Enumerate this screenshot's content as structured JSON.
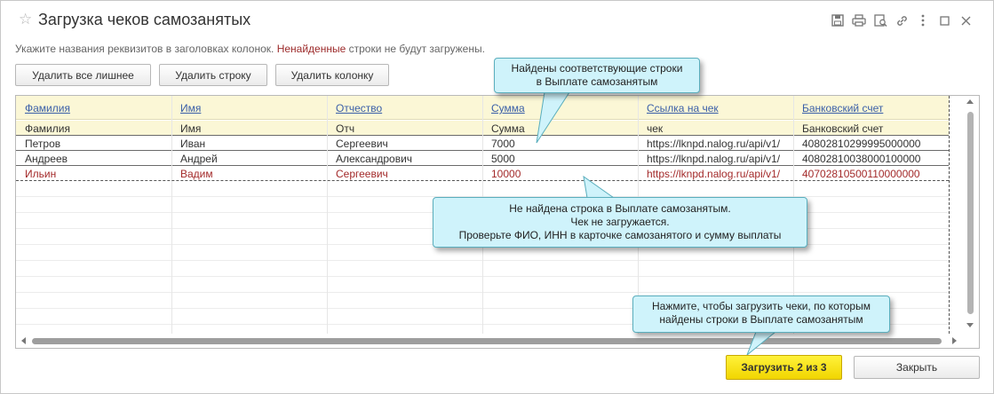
{
  "window": {
    "title": "Загрузка чеков самозанятых"
  },
  "hint": {
    "prefix": "Укажите названия реквизитов в заголовках колонок. ",
    "warning": "Ненайденные",
    "suffix": " строки не будут загружены."
  },
  "toolbar": {
    "delete_all_label": "Удалить все лишнее",
    "delete_row_label": "Удалить строку",
    "delete_column_label": "Удалить колонку"
  },
  "table": {
    "headers": [
      "Фамилия",
      "Имя",
      "Отчество",
      "Сумма",
      "Ссылка на чек",
      "Банковский счет"
    ],
    "rows": [
      [
        "Фамилия",
        "Имя",
        "Отч",
        "Сумма",
        "чек",
        "Банковский счет"
      ],
      [
        "Петров",
        "Иван",
        "Сергеевич",
        "7000",
        "https://lknpd.nalog.ru/api/v1/",
        "40802810299995000000"
      ],
      [
        "Андреев",
        "Андрей",
        "Александрович",
        "5000",
        "https://lknpd.nalog.ru/api/v1/",
        "40802810038000100000"
      ],
      [
        "Ильин",
        "Вадим",
        "Сергеевич",
        "10000",
        "https://lknpd.nalog.ru/api/v1/",
        "40702810500110000000"
      ]
    ]
  },
  "callouts": {
    "found": [
      "Найдены соответствующие строки",
      "в Выплате самозанятым"
    ],
    "not_found": [
      "Не найдена строка в Выплате самозанятым.",
      "Чек не загружается.",
      "Проверьте ФИО, ИНН в карточке самозанятого и сумму выплаты"
    ],
    "load_hint": [
      "Нажмите, чтобы загрузить чеки, по которым",
      "найдены строки в Выплате самозанятым"
    ]
  },
  "footer": {
    "load_label": "Загрузить 2 из 3",
    "close_label": "Закрыть"
  },
  "colors": {
    "header_bg": "#fbf7d6",
    "header_link": "#3a5fa8",
    "error_text": "#a32a2a",
    "callout_bg": "#cff3fb",
    "primary_button": "#f7e31c"
  },
  "icons": [
    "star-icon",
    "save-icon",
    "print-icon",
    "preview-icon",
    "link-icon",
    "more-icon",
    "maximize-icon",
    "close-icon"
  ]
}
